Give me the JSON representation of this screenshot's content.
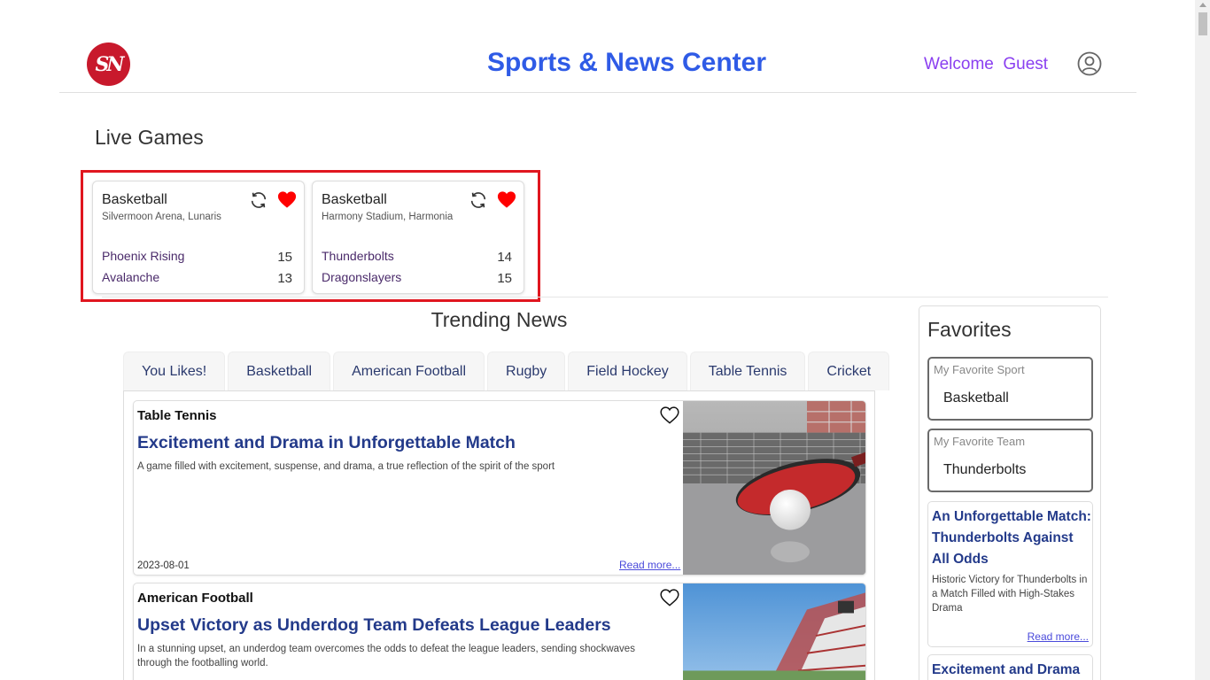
{
  "header": {
    "logo_text": "SN",
    "title": "Sports & News Center",
    "welcome": "Welcome  Guest"
  },
  "live_games": {
    "title": "Live Games",
    "games": [
      {
        "sport": "Basketball",
        "venue": "Silvermoon Arena, Lunaris",
        "team1": "Phoenix Rising",
        "score1": "15",
        "team2": "Avalanche",
        "score2": "13"
      },
      {
        "sport": "Basketball",
        "venue": "Harmony Stadium, Harmonia",
        "team1": "Thunderbolts",
        "score1": "14",
        "team2": "Dragonslayers",
        "score2": "15"
      }
    ]
  },
  "trending": {
    "title": "Trending News",
    "tabs": [
      "You Likes!",
      "Basketball",
      "American Football",
      "Rugby",
      "Field Hockey",
      "Table Tennis",
      "Cricket"
    ],
    "articles": [
      {
        "sport": "Table Tennis",
        "title": "Excitement and Drama in Unforgettable Match",
        "desc": "A game filled with excitement, suspense, and drama, a true reflection of the spirit of the sport",
        "date": "2023-08-01",
        "more": "Read more..."
      },
      {
        "sport": "American Football",
        "title": "Upset Victory as Underdog Team Defeats League Leaders",
        "desc": "In a stunning upset, an underdog team overcomes the odds to defeat the league leaders, sending shockwaves through the footballing world."
      }
    ]
  },
  "favorites": {
    "title": "Favorites",
    "sport_label": "My Favorite Sport",
    "sport_value": "Basketball",
    "team_label": "My Favorite Team",
    "team_value": "Thunderbolts",
    "news": [
      {
        "title": "An Unforgettable Match: Thunderbolts Against All Odds",
        "desc": "Historic Victory for Thunderbolts in a Match Filled with High-Stakes Drama",
        "more": "Read more..."
      },
      {
        "title": "Excitement and Drama"
      }
    ]
  },
  "colors": {
    "brand_blue": "#2f5be6",
    "welcome_purple": "#8a3ff0",
    "heart_red": "#ff0000",
    "highlight_red": "#e0161f",
    "logo_red": "#c8192c"
  }
}
